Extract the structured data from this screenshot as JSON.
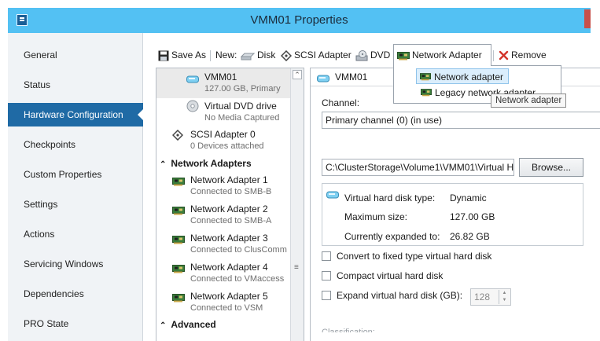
{
  "window": {
    "title": "VMM01 Properties"
  },
  "sidebar": {
    "items": [
      {
        "label": "General"
      },
      {
        "label": "Status"
      },
      {
        "label": "Hardware Configuration"
      },
      {
        "label": "Checkpoints"
      },
      {
        "label": "Custom Properties"
      },
      {
        "label": "Settings"
      },
      {
        "label": "Actions"
      },
      {
        "label": "Servicing Windows"
      },
      {
        "label": "Dependencies"
      },
      {
        "label": "PRO State"
      }
    ],
    "active_index": 2
  },
  "toolbar": {
    "save_as": "Save As",
    "new_label": "New:",
    "disk": "Disk",
    "scsi_adapter": "SCSI Adapter",
    "dvd": "DVD",
    "network_adapter": "Network Adapter",
    "remove": "Remove"
  },
  "dropdown": {
    "items": [
      {
        "label": "Network adapter"
      },
      {
        "label": "Legacy network adapter"
      }
    ],
    "tooltip": "Network adapter"
  },
  "hardware_list": {
    "items": [
      {
        "title": "VMM01",
        "subtitle": "127.00 GB, Primary",
        "icon": "disk-icon"
      },
      {
        "title": "Virtual DVD drive",
        "subtitle": "No Media Captured",
        "icon": "dvd-icon"
      },
      {
        "title": "SCSI Adapter 0",
        "subtitle": "0 Devices attached",
        "icon": "scsi-icon"
      }
    ],
    "network_section": "Network Adapters",
    "network_adapters": [
      {
        "title": "Network Adapter 1",
        "subtitle": "Connected to SMB-B"
      },
      {
        "title": "Network Adapter 2",
        "subtitle": "Connected to SMB-A"
      },
      {
        "title": "Network Adapter 3",
        "subtitle": "Connected to ClusComm"
      },
      {
        "title": "Network Adapter 4",
        "subtitle": "Connected to VMaccess"
      },
      {
        "title": "Network Adapter 5",
        "subtitle": "Connected to VSM"
      }
    ],
    "advanced_section": "Advanced"
  },
  "details": {
    "header": "VMM01",
    "channel_label": "Channel:",
    "channel_value": "Primary channel (0) (in use)",
    "path_value": "C:\\ClusterStorage\\Volume1\\VMM01\\Virtual H",
    "browse_button": "Browse...",
    "disk_type_label": "Virtual hard disk type:",
    "disk_type_value": "Dynamic",
    "max_size_label": "Maximum size:",
    "max_size_value": "127.00 GB",
    "expanded_label": "Currently expanded to:",
    "expanded_value": "26.82 GB",
    "convert_label": "Convert to fixed type virtual hard disk",
    "compact_label": "Compact virtual hard disk",
    "expand_label": "Expand virtual hard disk (GB):",
    "expand_value": "128",
    "classification_label": "Classification:"
  },
  "colors": {
    "titlebar": "#53c1f3",
    "active_nav": "#1f6aa5",
    "sidebar_bg": "#f0f3f6"
  }
}
